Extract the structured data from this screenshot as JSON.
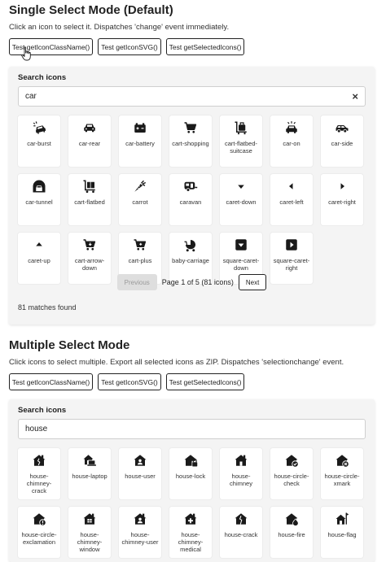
{
  "single": {
    "title": "Single Select Mode (Default)",
    "description": "Click an icon to select it. Dispatches 'change' event immediately.",
    "buttons": [
      "Test getIconClassName()",
      "Test getIconSVG()",
      "Test getSelectedIcons()"
    ],
    "search_label": "Search icons",
    "search_value": "car",
    "clear_label": "×",
    "icons": [
      {
        "label": "car-burst",
        "icon": "car-burst-icon"
      },
      {
        "label": "car-rear",
        "icon": "car-rear-icon"
      },
      {
        "label": "car-battery",
        "icon": "car-battery-icon"
      },
      {
        "label": "cart-shopping",
        "icon": "cart-shopping-icon"
      },
      {
        "label": "cart-flatbed-suitcase",
        "icon": "cart-flatbed-suitcase-icon"
      },
      {
        "label": "car-on",
        "icon": "car-on-icon"
      },
      {
        "label": "car-side",
        "icon": "car-side-icon"
      },
      {
        "label": "car-tunnel",
        "icon": "car-tunnel-icon"
      },
      {
        "label": "cart-flatbed",
        "icon": "cart-flatbed-icon"
      },
      {
        "label": "carrot",
        "icon": "carrot-icon"
      },
      {
        "label": "caravan",
        "icon": "caravan-icon"
      },
      {
        "label": "caret-down",
        "icon": "caret-down-icon"
      },
      {
        "label": "caret-left",
        "icon": "caret-left-icon"
      },
      {
        "label": "caret-right",
        "icon": "caret-right-icon"
      },
      {
        "label": "caret-up",
        "icon": "caret-up-icon"
      },
      {
        "label": "cart-arrow-down",
        "icon": "cart-arrow-down-icon"
      },
      {
        "label": "cart-plus",
        "icon": "cart-plus-icon"
      },
      {
        "label": "baby-carriage",
        "icon": "baby-carriage-icon"
      },
      {
        "label": "square-caret-down",
        "icon": "square-caret-down-icon"
      },
      {
        "label": "square-caret-right",
        "icon": "square-caret-right-icon"
      }
    ],
    "pagination": {
      "previous": "Previous",
      "info": "Page 1 of 5 (81 icons)",
      "next": "Next"
    },
    "matches": "81 matches found"
  },
  "multiple": {
    "title": "Multiple Select Mode",
    "description": "Click icons to select multiple. Export all selected icons as ZIP. Dispatches 'selectionchange' event.",
    "buttons": [
      "Test getIconClassName()",
      "Test getIconSVG()",
      "Test getSelectedIcons()"
    ],
    "search_label": "Search icons",
    "search_value": "house",
    "icons": [
      {
        "label": "house-chimney-crack",
        "icon": "house-chimney-crack-icon"
      },
      {
        "label": "house-laptop",
        "icon": "house-laptop-icon"
      },
      {
        "label": "house-user",
        "icon": "house-user-icon"
      },
      {
        "label": "house-lock",
        "icon": "house-lock-icon"
      },
      {
        "label": "house-chimney",
        "icon": "house-chimney-icon"
      },
      {
        "label": "house-circle-check",
        "icon": "house-circle-check-icon"
      },
      {
        "label": "house-circle-xmark",
        "icon": "house-circle-xmark-icon"
      },
      {
        "label": "house-circle-exclamation",
        "icon": "house-circle-exclamation-icon"
      },
      {
        "label": "house-chimney-window",
        "icon": "house-chimney-window-icon"
      },
      {
        "label": "house-chimney-user",
        "icon": "house-chimney-user-icon"
      },
      {
        "label": "house-chimney-medical",
        "icon": "house-chimney-medical-icon"
      },
      {
        "label": "house-crack",
        "icon": "house-crack-icon"
      },
      {
        "label": "house-fire",
        "icon": "house-fire-icon"
      },
      {
        "label": "house-flag",
        "icon": "house-flag-icon"
      }
    ]
  }
}
